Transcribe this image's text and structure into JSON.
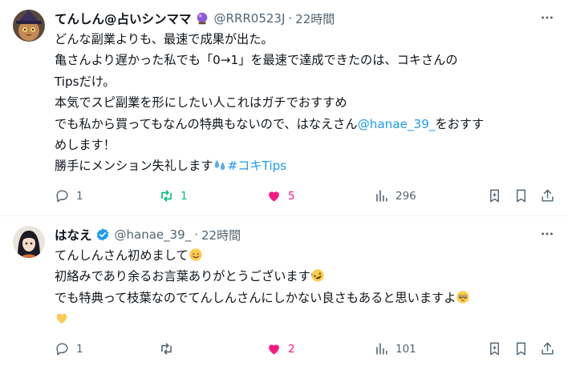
{
  "tweets": [
    {
      "name": "てんしん@占いシンママ",
      "handle": "@RRR0523J",
      "dot": "·",
      "time": "22時間",
      "lines": [
        "どんな副業よりも、最速で成果が出た。",
        "亀さんより遅かった私でも「0→1」を最速で達成できたのは、コキさんの",
        "Tipsだけ。",
        "本気でスピ副業を形にしたい人これはガチでおすすめ",
        "でも私から買ってもなんの特典もないので、はなえさん",
        "@hanae_39_",
        "をおすす",
        "めします！",
        "勝手にメンション失礼します",
        "#コキTips"
      ],
      "stats": {
        "replies": "1",
        "retweets": "1",
        "likes": "5",
        "views": "296"
      },
      "colors": {
        "retweet_active": "#00ba7c",
        "like_active": "#f91880"
      },
      "icons": [
        "crystal-ball-icon",
        "sweat-droplets-icon"
      ]
    },
    {
      "name": "はなえ",
      "handle": "@hanae_39_",
      "dot": "·",
      "time": "22時間",
      "lines": [
        "てんしんさん初めまして",
        "初絡みであり余るお言葉ありがとうございます",
        "でも特典って枝葉なのでてんしんさんにしかない良さもあると思いますよ"
      ],
      "stats": {
        "replies": "1",
        "retweets": "",
        "likes": "2",
        "views": "101"
      },
      "colors": {
        "like_active": "#f91880",
        "verified": "#1d9bf0"
      },
      "icons": [
        "smiling-face-icon",
        "rolling-laughing-icon",
        "pleading-face-icon",
        "yellow-heart-icon"
      ]
    }
  ],
  "theme": {
    "text": "#0f1419",
    "muted": "#536471",
    "link": "#1d9bf0",
    "divider": "#eff3f4"
  }
}
